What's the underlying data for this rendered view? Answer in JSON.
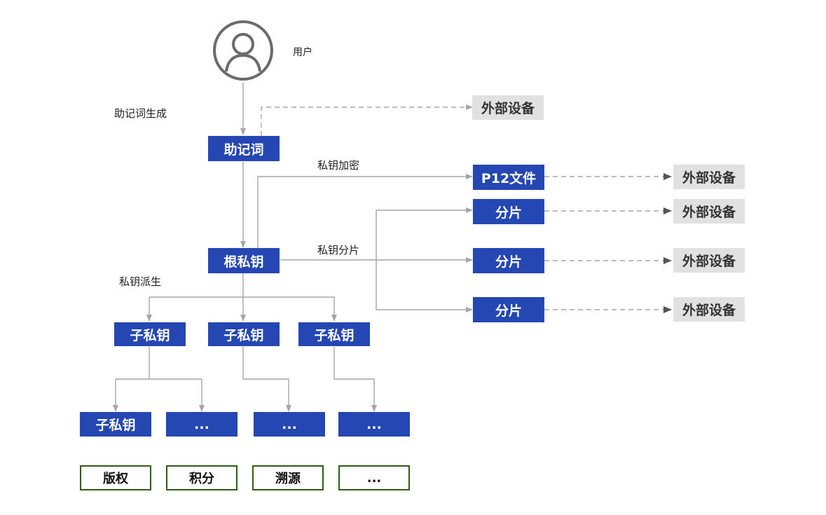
{
  "user": {
    "label": "用户",
    "icon": "user-icon"
  },
  "labels": {
    "mnemonic_generation": "助记词生成",
    "key_encryption": "私钥加密",
    "key_sharding": "私钥分片",
    "key_derivation": "私钥派生"
  },
  "nodes": {
    "mnemonic": "助记词",
    "root_key": "根私钥",
    "p12_file": "P12文件",
    "shard_1": "分片",
    "shard_2": "分片",
    "shard_3": "分片",
    "child_key_1": "子私钥",
    "child_key_2": "子私钥",
    "child_key_3": "子私钥",
    "grandchild_key": "子私钥",
    "more_1": "...",
    "more_2": "...",
    "more_3": "..."
  },
  "external_devices": [
    "外部设备",
    "外部设备",
    "外部设备",
    "外部设备",
    "外部设备"
  ],
  "applications": [
    "版权",
    "积分",
    "溯源",
    "..."
  ],
  "colors": {
    "node_blue": "#2447b3",
    "device_grey": "#e1e1e1",
    "app_border_green": "#2f5d12",
    "line_grey": "#a6a6a6",
    "icon_grey": "#6b6b6b"
  }
}
